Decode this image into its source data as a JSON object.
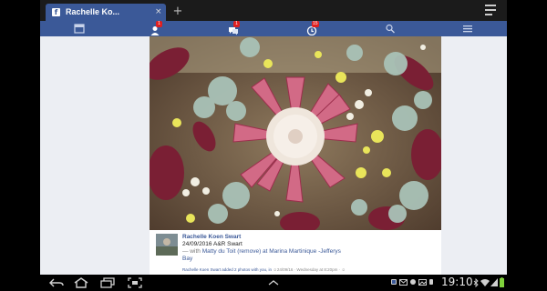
{
  "browser": {
    "tab_title": "Rachelle Ko...",
    "favicon": "facebook-favicon",
    "close_glyph": "×",
    "newtab_glyph": "+",
    "menu_icon": "browser-menu-icon"
  },
  "fb_nav": {
    "icons": [
      "news-feed-icon",
      "friend-requests-icon",
      "messages-icon",
      "notifications-icon",
      "search-icon",
      "menu-icon"
    ],
    "badges": {
      "friend_requests": "1",
      "messages": "1",
      "notifications": "15"
    }
  },
  "post": {
    "author": "Rachelle Koen Swart",
    "meta": "24/09/2016 A&R Swart",
    "with_prefix": "—  with",
    "with_text": "Matty du Toit (remove) at Marina Martinique -Jefferys",
    "location_cont": "Bay",
    "footer_link": "Rachelle Koen Swart added 2 photos with you, in ",
    "footer_grey": "☺24/09/16 · Wednesday at 8:20pm · ☺"
  },
  "system": {
    "clock": "19:10",
    "nav_icons": [
      "back-icon",
      "home-icon",
      "recent-apps-icon",
      "screenshot-icon"
    ],
    "status_icons": [
      "facebook-notif-icon",
      "mail-icon",
      "gallery-icon",
      "bluetooth-icon",
      "wifi-icon",
      "signal-icon",
      "battery-icon"
    ]
  },
  "colors": {
    "facebook_blue": "#3b5998",
    "badge_red": "#e02020",
    "page_bg": "#eceef3"
  }
}
